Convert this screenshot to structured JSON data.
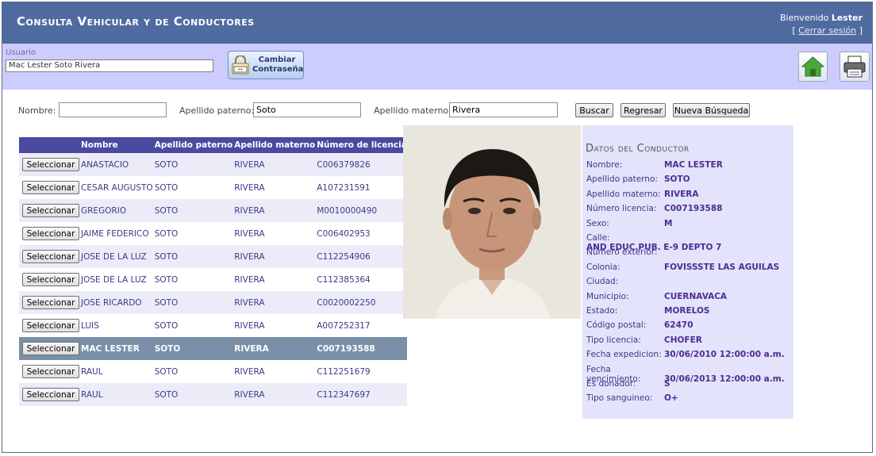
{
  "header": {
    "title": "Consulta Vehicular y de Conductores",
    "welcome_prefix": "Bienvenido",
    "welcome_user": "Lester",
    "logout": "Cerrar sesión"
  },
  "userbar": {
    "label": "Usuario",
    "value": "Mac Lester Soto Rivera",
    "change_password_line1": "Cambiar",
    "change_password_line2": "Contraseña",
    "home_icon": "home-icon",
    "print_icon": "printer-icon"
  },
  "search": {
    "nombre_label": "Nombre:",
    "nombre_value": "",
    "paterno_label": "Apellido paterno:",
    "paterno_value": "Soto",
    "materno_label": "Apellido materno:",
    "materno_value": "Rivera",
    "buscar": "Buscar",
    "regresar": "Regresar",
    "nueva": "Nueva Búsqueda"
  },
  "table": {
    "headers": [
      "",
      "Nombre",
      "Apellido paterno",
      "Apellido materno",
      "Número de licencia"
    ],
    "button_label": "Seleccionar",
    "selected_index": 8,
    "rows": [
      [
        "ANASTACIO",
        "SOTO",
        "RIVERA",
        "C006379826"
      ],
      [
        "CESAR AUGUSTO",
        "SOTO",
        "RIVERA",
        "A107231591"
      ],
      [
        "GREGORIO",
        "SOTO",
        "RIVERA",
        "M0010000490"
      ],
      [
        "JAIME FEDERICO",
        "SOTO",
        "RIVERA",
        "C006402953"
      ],
      [
        "JOSE DE LA LUZ",
        "SOTO",
        "RIVERA",
        "C112254906"
      ],
      [
        "JOSE DE LA LUZ",
        "SOTO",
        "RIVERA",
        "C112385364"
      ],
      [
        "JOSE RICARDO",
        "SOTO",
        "RIVERA",
        "C0020002250"
      ],
      [
        "LUIS",
        "SOTO",
        "RIVERA",
        "A007252317"
      ],
      [
        "MAC LESTER",
        "SOTO",
        "RIVERA",
        "C007193588"
      ],
      [
        "RAUL",
        "SOTO",
        "RIVERA",
        "C112251679"
      ],
      [
        "RAUL",
        "SOTO",
        "RIVERA",
        "C112347697"
      ]
    ]
  },
  "details": {
    "title": "Datos del Conductor",
    "fields": [
      {
        "label": "Nombre:",
        "value": "MAC LESTER"
      },
      {
        "label": "Apellido paterno:",
        "value": "SOTO"
      },
      {
        "label": "Apellido materno:",
        "value": "RIVERA"
      },
      {
        "label": "Número licencia:",
        "value": "C007193588"
      },
      {
        "label": "Sexo:",
        "value": "M"
      },
      {
        "label": "Calle:",
        "value": "AND EDUC.PUB. E-9 DEPTO 7"
      },
      {
        "label": "Número exterior:",
        "value": ""
      },
      {
        "label": "Colonia:",
        "value": "FOVISSSTE LAS AGUILAS"
      },
      {
        "label": "Ciudad:",
        "value": ""
      },
      {
        "label": "Municipio:",
        "value": "CUERNAVACA"
      },
      {
        "label": "Estado:",
        "value": "MORELOS"
      },
      {
        "label": "Código postal:",
        "value": "62470"
      },
      {
        "label": "Tipo licencia:",
        "value": "CHOFER"
      },
      {
        "label": "Fecha expedicion:",
        "value": "30/06/2010 12:00:00 a.m."
      },
      {
        "label": "Fecha vencimiento:",
        "value": "30/06/2013 12:00:00 a.m."
      },
      {
        "label": "Es donador:",
        "value": "S"
      },
      {
        "label": "Tipo sanguineo:",
        "value": "O+"
      }
    ]
  },
  "colors": {
    "header_bg": "#4f6b9f",
    "userbar_bg": "#ccccff",
    "table_header": "#4a4aa0",
    "selected_row": "#7a8fa8",
    "details_bg": "#e3e3fb"
  }
}
